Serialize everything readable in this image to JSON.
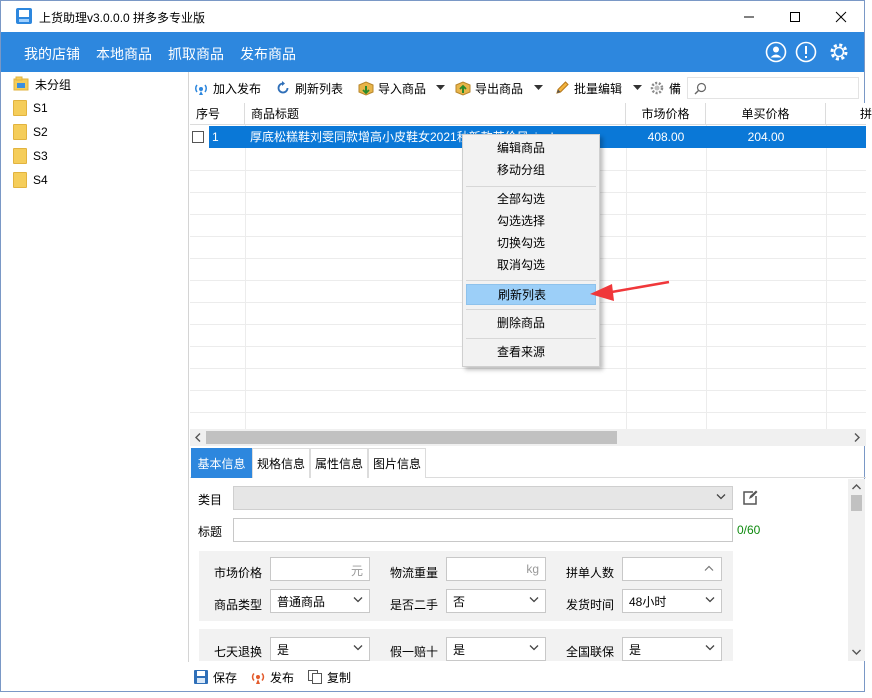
{
  "window": {
    "title": "上货助理v3.0.0.0 拼多多专业版",
    "minimize_icon": "minimize-icon",
    "maximize_icon": "maximize-icon",
    "close_icon": "close-icon"
  },
  "menubar": {
    "items": [
      "我的店铺",
      "本地商品",
      "抓取商品",
      "发布商品"
    ],
    "right_icons": [
      "user-icon",
      "info-icon",
      "settings-icon"
    ]
  },
  "tree": {
    "items": [
      {
        "label": "未分组",
        "icon": "folder-group-icon"
      },
      {
        "label": "S1",
        "icon": "folder-icon"
      },
      {
        "label": "S2",
        "icon": "folder-icon"
      },
      {
        "label": "S3",
        "icon": "folder-icon"
      },
      {
        "label": "S4",
        "icon": "folder-icon"
      }
    ]
  },
  "toolbar": {
    "add_publish": "加入发布",
    "refresh_list": "刷新列表",
    "import_goods": "导入商品",
    "export_goods": "导出商品",
    "batch_edit": "批量编辑",
    "backup": "備",
    "search_placeholder": ""
  },
  "grid": {
    "columns": [
      "序号",
      "商品标题",
      "市场价格",
      "单买价格",
      "拼"
    ],
    "rows": [
      {
        "index": "1",
        "title": "厚底松糕鞋刘雯同款增高小皮鞋女2021秋新款英伦风single…",
        "market_price": "408.00",
        "single_price": "204.00"
      }
    ]
  },
  "context_menu": {
    "items": [
      "编辑商品",
      "移动分组",
      "全部勾选",
      "勾选选择",
      "切换勾选",
      "取消勾选",
      "刷新列表",
      "删除商品",
      "查看来源"
    ],
    "highlighted": "刷新列表"
  },
  "detail_tabs": [
    "基本信息",
    "规格信息",
    "属性信息",
    "图片信息"
  ],
  "form": {
    "category_label": "类目",
    "title_label": "标题",
    "title_counter": "0/60",
    "market_price_label": "市场价格",
    "market_price_unit": "元",
    "weight_label": "物流重量",
    "weight_unit": "kg",
    "group_size_label": "拼单人数",
    "goods_type_label": "商品类型",
    "goods_type_value": "普通商品",
    "second_hand_label": "是否二手",
    "second_hand_value": "否",
    "ship_time_label": "发货时间",
    "ship_time_value": "48小时",
    "return_label": "七天退换",
    "return_value": "是",
    "fake_label": "假一赔十",
    "fake_value": "是",
    "warranty_label": "全国联保",
    "warranty_value": "是"
  },
  "statusbar": {
    "save": "保存",
    "publish": "发布",
    "copy": "复制"
  },
  "colors": {
    "accent": "#2d87de",
    "selection": "#0a78d7",
    "highlight": "#9ccff8",
    "arrow": "#f0373a",
    "counter": "#0f8a0f"
  }
}
